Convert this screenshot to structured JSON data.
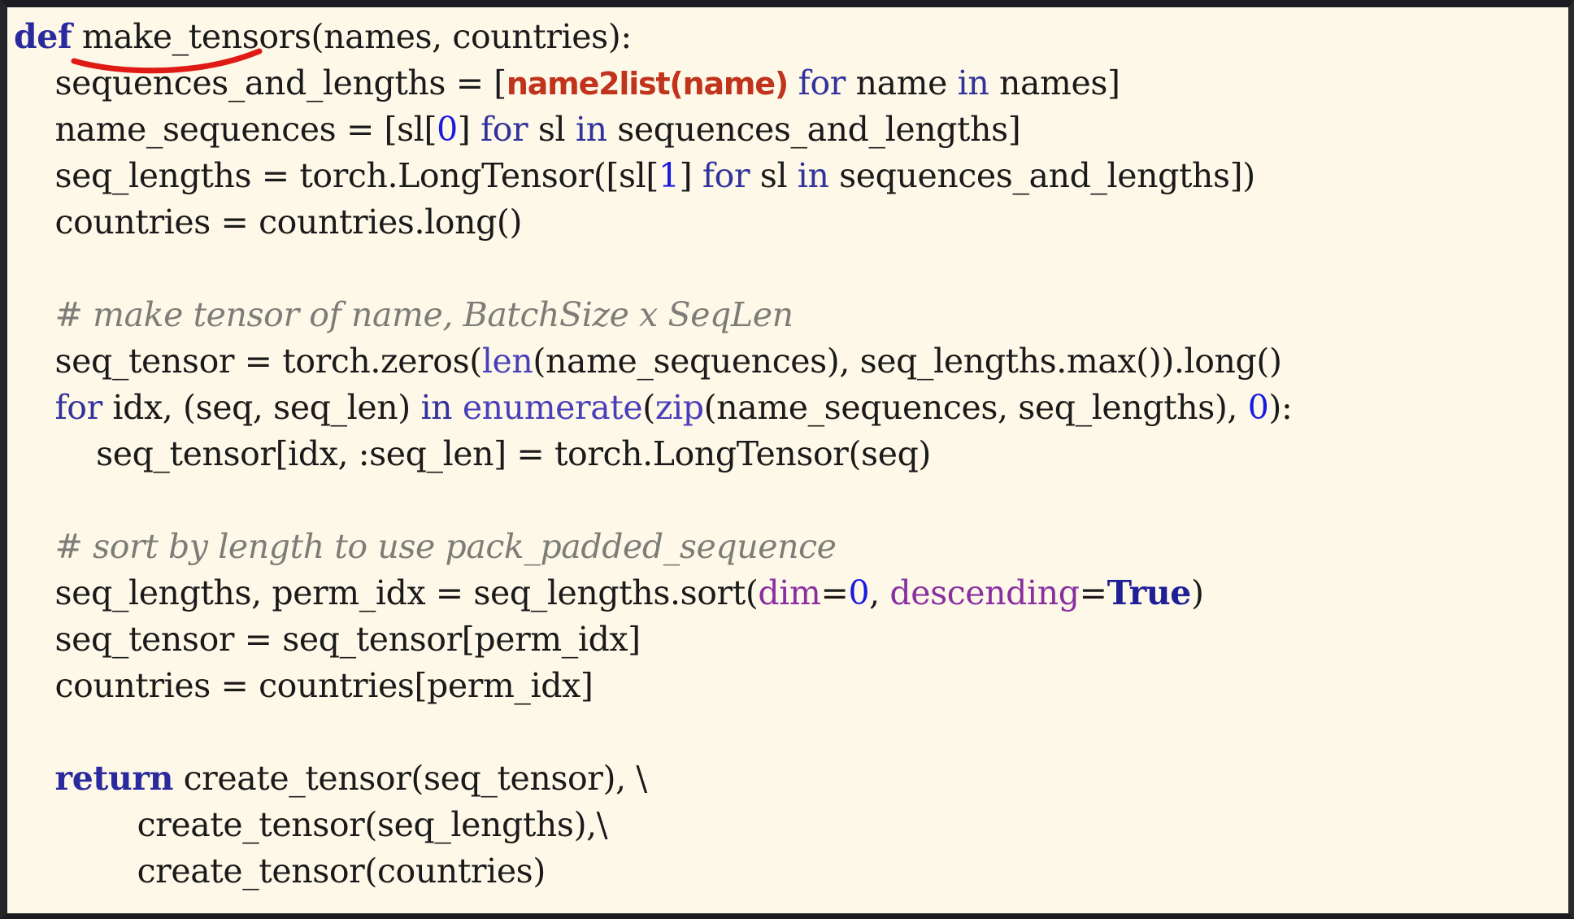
{
  "slide": {
    "kind": "code-listing",
    "language": "python",
    "background_color": "#fdf8e8",
    "border_color": "#1c1c20",
    "default_text_color": "#1a1a1a",
    "colors": {
      "keyword": "#2a2a9e",
      "builtin": "#4a3fbb",
      "number": "#1a1ae0",
      "constant": "#1f1f96",
      "kwarg": "#8a2fa0",
      "comment": "#7d7d78",
      "highlight": "#c0341d",
      "annotation": "#e01b15"
    }
  },
  "annotation": {
    "name": "red-underline",
    "shape": "hand-drawn-curve",
    "color": "#e01b15",
    "underlines_text": "make_tensors"
  },
  "code": {
    "lines": [
      {
        "indent": 0,
        "tokens": [
          {
            "t": "def",
            "c": "kw"
          },
          {
            "t": " make_tensors",
            "c": "plain"
          },
          {
            "t": "(names, ",
            "c": "plain"
          },
          {
            "t": "countries):",
            "c": "plain"
          }
        ]
      },
      {
        "indent": 1,
        "tokens": [
          {
            "t": "sequences_and_lengths = [",
            "c": "plain"
          },
          {
            "t": "name2list(name)",
            "c": "hl"
          },
          {
            "t": " ",
            "c": "plain"
          },
          {
            "t": "for",
            "c": "kw-soft"
          },
          {
            "t": " name ",
            "c": "plain"
          },
          {
            "t": "in",
            "c": "kw-soft"
          },
          {
            "t": " names]",
            "c": "plain"
          }
        ]
      },
      {
        "indent": 1,
        "tokens": [
          {
            "t": "name_sequences = [sl[",
            "c": "plain"
          },
          {
            "t": "0",
            "c": "num"
          },
          {
            "t": "] ",
            "c": "plain"
          },
          {
            "t": "for",
            "c": "kw-soft"
          },
          {
            "t": " sl ",
            "c": "plain"
          },
          {
            "t": "in",
            "c": "kw-soft"
          },
          {
            "t": " sequences_and_lengths]",
            "c": "plain"
          }
        ]
      },
      {
        "indent": 1,
        "tokens": [
          {
            "t": "seq_lengths = torch.LongTensor([sl[",
            "c": "plain"
          },
          {
            "t": "1",
            "c": "num"
          },
          {
            "t": "] ",
            "c": "plain"
          },
          {
            "t": "for",
            "c": "kw-soft"
          },
          {
            "t": " sl ",
            "c": "plain"
          },
          {
            "t": "in",
            "c": "kw-soft"
          },
          {
            "t": " sequences_and_lengths])",
            "c": "plain"
          }
        ]
      },
      {
        "indent": 1,
        "tokens": [
          {
            "t": "countries = countries.long()",
            "c": "plain"
          }
        ]
      },
      {
        "indent": 0,
        "tokens": []
      },
      {
        "indent": 1,
        "tokens": [
          {
            "t": "# make tensor of name, BatchSize x SeqLen",
            "c": "comment"
          }
        ]
      },
      {
        "indent": 1,
        "tokens": [
          {
            "t": "seq_tensor = torch.zeros(",
            "c": "plain"
          },
          {
            "t": "len",
            "c": "builtin"
          },
          {
            "t": "(name_sequences), seq_lengths.max()).long()",
            "c": "plain"
          }
        ]
      },
      {
        "indent": 1,
        "tokens": [
          {
            "t": "for",
            "c": "kw-soft"
          },
          {
            "t": " idx, (seq, seq_len) ",
            "c": "plain"
          },
          {
            "t": "in",
            "c": "kw-soft"
          },
          {
            "t": " ",
            "c": "plain"
          },
          {
            "t": "enumerate",
            "c": "builtin"
          },
          {
            "t": "(",
            "c": "plain"
          },
          {
            "t": "zip",
            "c": "builtin"
          },
          {
            "t": "(name_sequences, seq_lengths), ",
            "c": "plain"
          },
          {
            "t": "0",
            "c": "num"
          },
          {
            "t": "):",
            "c": "plain"
          }
        ]
      },
      {
        "indent": 2,
        "tokens": [
          {
            "t": "seq_tensor[idx, :seq_len] = torch.LongTensor(seq)",
            "c": "plain"
          }
        ]
      },
      {
        "indent": 0,
        "tokens": []
      },
      {
        "indent": 1,
        "tokens": [
          {
            "t": "# sort by length to use pack_padded_sequence",
            "c": "comment"
          }
        ]
      },
      {
        "indent": 1,
        "tokens": [
          {
            "t": "seq_lengths, perm_idx = seq_lengths.sort(",
            "c": "plain"
          },
          {
            "t": "dim",
            "c": "kwarg"
          },
          {
            "t": "=",
            "c": "plain"
          },
          {
            "t": "0",
            "c": "num"
          },
          {
            "t": ", ",
            "c": "plain"
          },
          {
            "t": "descending",
            "c": "kwarg"
          },
          {
            "t": "=",
            "c": "plain"
          },
          {
            "t": "True",
            "c": "const"
          },
          {
            "t": ")",
            "c": "plain"
          }
        ]
      },
      {
        "indent": 1,
        "tokens": [
          {
            "t": "seq_tensor = seq_tensor[perm_idx]",
            "c": "plain"
          }
        ]
      },
      {
        "indent": 1,
        "tokens": [
          {
            "t": "countries = countries[perm_idx]",
            "c": "plain"
          }
        ]
      },
      {
        "indent": 0,
        "tokens": []
      },
      {
        "indent": 1,
        "tokens": [
          {
            "t": "return",
            "c": "kw"
          },
          {
            "t": " create_tensor(seq_tensor), \\",
            "c": "plain"
          }
        ]
      },
      {
        "indent": 3,
        "tokens": [
          {
            "t": "create_tensor(seq_lengths),\\",
            "c": "plain"
          }
        ]
      },
      {
        "indent": 3,
        "tokens": [
          {
            "t": "create_tensor(countries)",
            "c": "plain"
          }
        ]
      }
    ]
  }
}
